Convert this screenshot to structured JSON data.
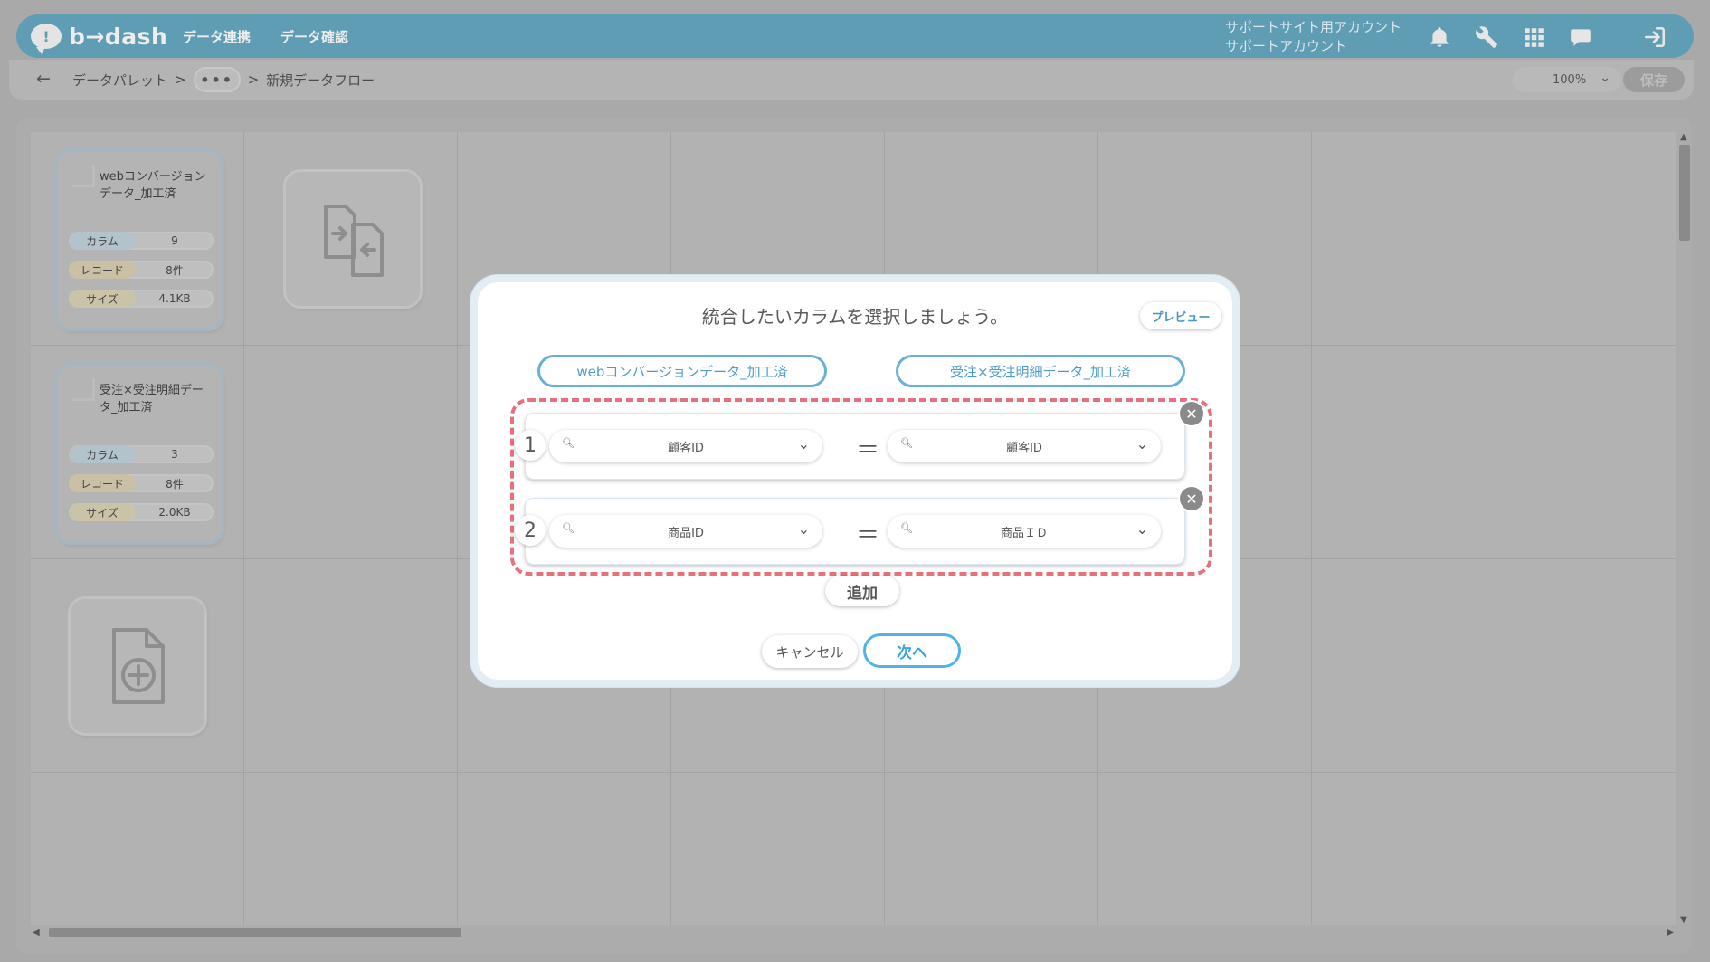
{
  "app": {
    "logo_text": "b→dash",
    "nav": [
      "データ連携",
      "データ確認"
    ],
    "account_line1": "サポートサイト用アカウント",
    "account_line2": "サポートアカウント"
  },
  "breadcrumb": {
    "back": "←",
    "root": "データパレット",
    "separator": ">",
    "more": "•••",
    "current": "新規データフロー"
  },
  "toolbar": {
    "zoom": "100%",
    "save_label": "保存"
  },
  "cards": [
    {
      "name": "webコンバージョンデータ_加工済",
      "stats": [
        {
          "key": "カラム",
          "value": "9",
          "color": "#b3c3cc"
        },
        {
          "key": "レコード",
          "value": "8件",
          "color": "#c9c0a6"
        },
        {
          "key": "サイズ",
          "value": "4.1KB",
          "color": "#c9c3a8"
        }
      ]
    },
    {
      "name": "受注×受注明細データ_加工済",
      "stats": [
        {
          "key": "カラム",
          "value": "3",
          "color": "#b3c3cc"
        },
        {
          "key": "レコード",
          "value": "8件",
          "color": "#c9c0a6"
        },
        {
          "key": "サイズ",
          "value": "2.0KB",
          "color": "#c9c3a8"
        }
      ]
    }
  ],
  "modal": {
    "title": "統合したいカラムを選択しましょう。",
    "preview_label": "プレビュー",
    "left_source": "webコンバージョンデータ_加工済",
    "right_source": "受注×受注明細データ_加工済",
    "pairs": [
      {
        "num": "1",
        "left": "顧客ID",
        "right": "顧客ID"
      },
      {
        "num": "2",
        "left": "商品ID",
        "right": "商品ＩＤ"
      }
    ],
    "equals": "＝",
    "add_label": "追加",
    "cancel_label": "キャンセル",
    "next_label": "次へ"
  },
  "colors": {
    "header": "#5f9db5",
    "accent_blue": "#4fb3e6",
    "highlight_dash": "#e8707a"
  }
}
